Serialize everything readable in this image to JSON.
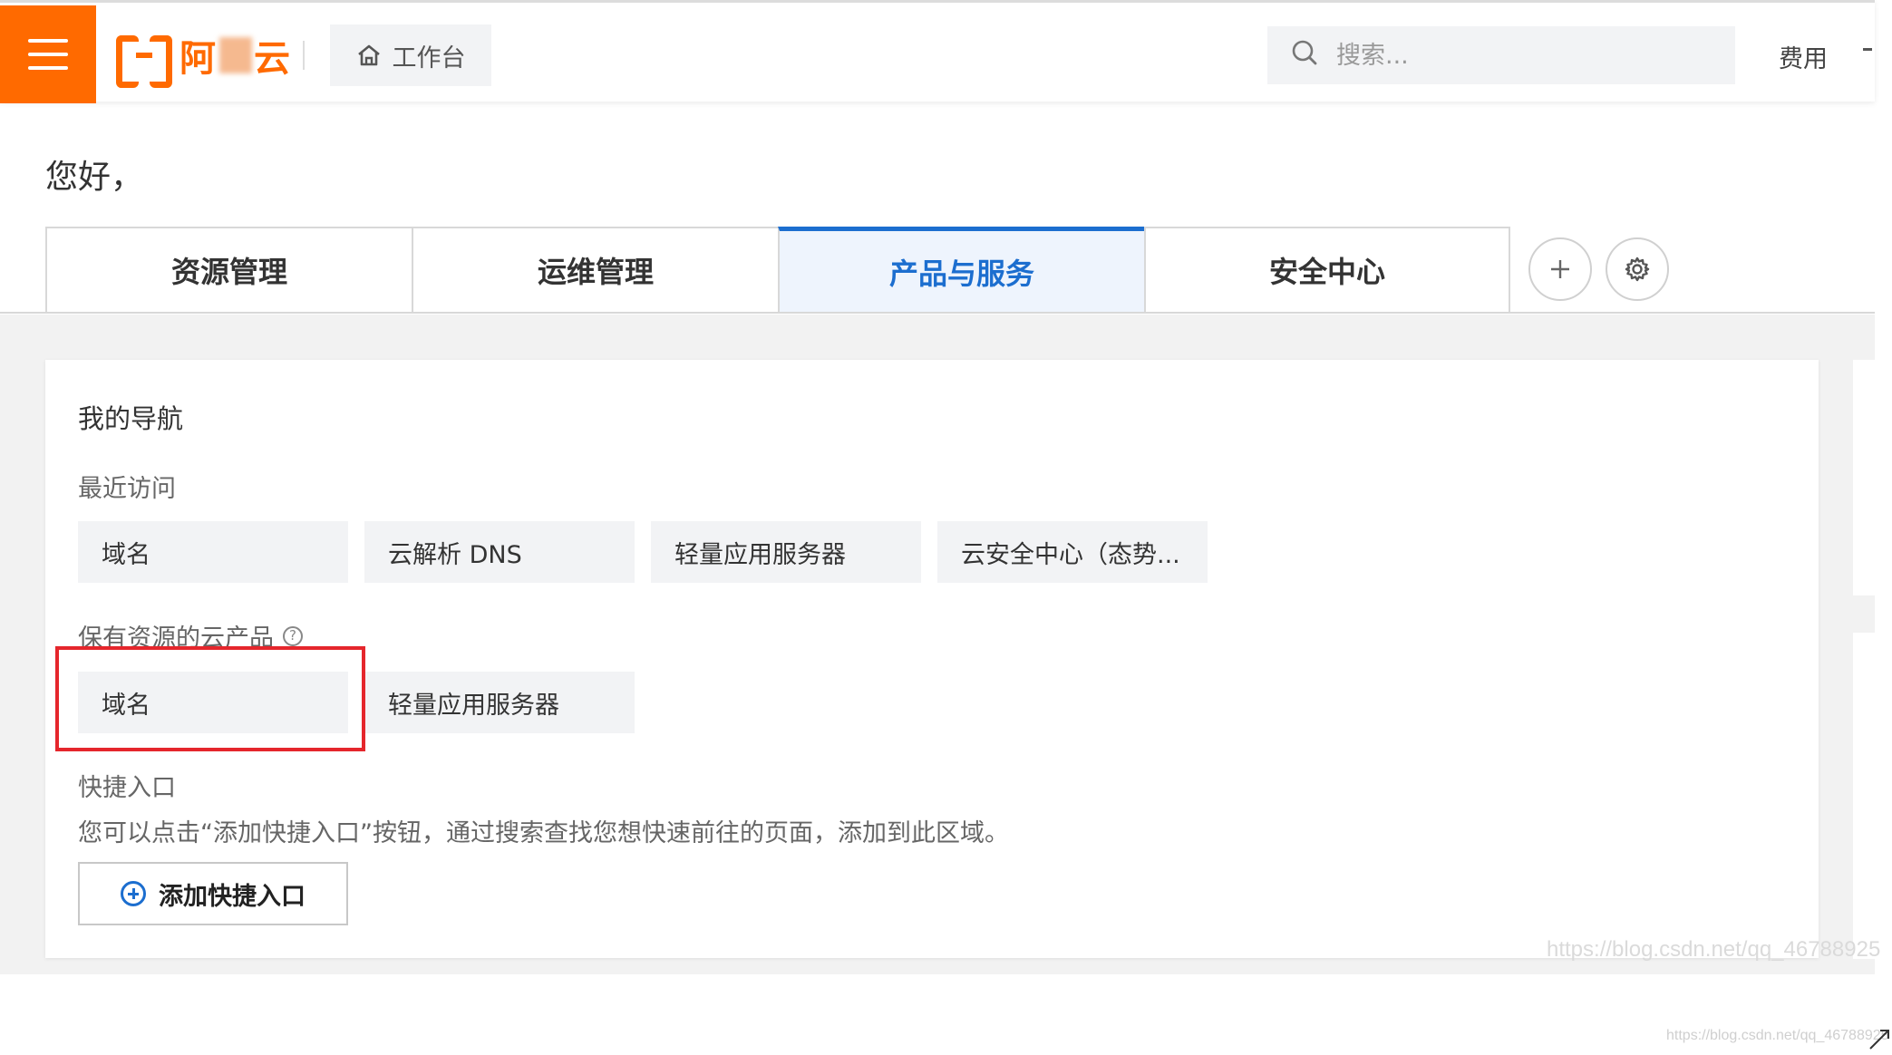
{
  "header": {
    "logo_text": "阿里云",
    "workbench_label": "工作台",
    "search_placeholder": "搜索...",
    "fee_label": "费用"
  },
  "greeting": {
    "text": "您好，"
  },
  "tabs": [
    {
      "label": "资源管理",
      "active": false
    },
    {
      "label": "运维管理",
      "active": false
    },
    {
      "label": "产品与服务",
      "active": true
    },
    {
      "label": "安全中心",
      "active": false
    }
  ],
  "nav": {
    "title": "我的导航",
    "recent": {
      "label": "最近访问",
      "items": [
        "域名",
        "云解析 DNS",
        "轻量应用服务器",
        "云安全中心（态势..."
      ]
    },
    "owned": {
      "label": "保有资源的云产品",
      "items": [
        "域名",
        "轻量应用服务器"
      ]
    },
    "quick": {
      "label": "快捷入口",
      "description": "您可以点击“添加快捷入口”按钮，通过搜索查找您想快速前往的页面，添加到此区域。",
      "add_button": "添加快捷入口"
    }
  },
  "watermark": {
    "main": "https://blog.csdn.net/qq_46788925",
    "corner": "https://blog.csdn.net/qq_46788925"
  },
  "colors": {
    "brand": "#ff6a00",
    "accent": "#1c6ecf",
    "highlight": "#e5262c"
  }
}
